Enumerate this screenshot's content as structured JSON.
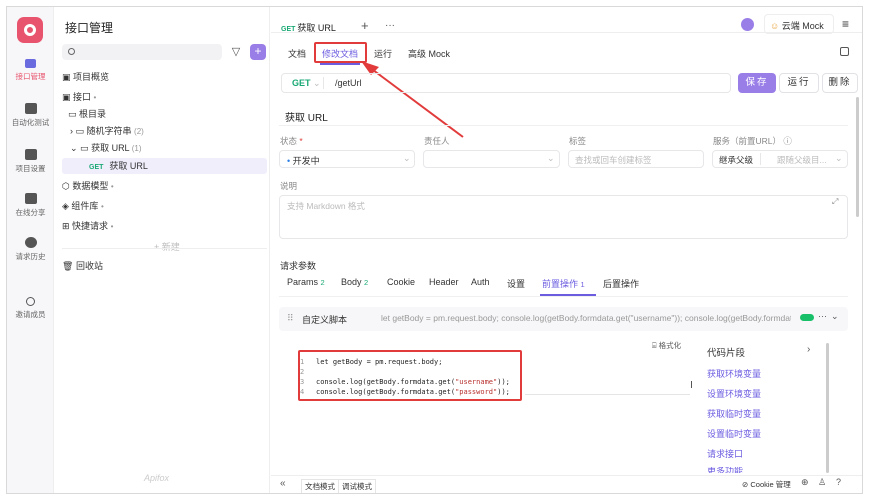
{
  "rail": {
    "items": [
      {
        "label": "接口管理",
        "icon": "api-icon"
      },
      {
        "label": "自动化测试",
        "icon": "automation-icon"
      },
      {
        "label": "项目设置",
        "icon": "settings-icon"
      },
      {
        "label": "在线分享",
        "icon": "share-icon"
      },
      {
        "label": "请求历史",
        "icon": "history-icon"
      },
      {
        "label": "邀请成员",
        "icon": "invite-icon"
      }
    ]
  },
  "tree": {
    "title": "接口管理",
    "search_placeholder": "",
    "items": {
      "overview": "项目概览",
      "interface": "接口",
      "interface_caret": "•",
      "root": "根目录",
      "random_string": "随机字符串",
      "random_string_count": "(2)",
      "get_url_folder": "获取 URL",
      "get_url_folder_count": "(1)",
      "get_method": "GET",
      "get_url": "获取 URL",
      "data_model": "数据模型",
      "component_lib": "组件库",
      "quick_request": "快捷请求",
      "new": "+ 新建",
      "recycle": "回收站"
    },
    "watermark": "Apifox"
  },
  "tabs": {
    "method": "GET",
    "title": "获取 URL",
    "add": "+",
    "more": "···"
  },
  "topright": {
    "env_label": "云端 Mock",
    "menu": "≡"
  },
  "subtabs": [
    "文档",
    "修改文档",
    "运行",
    "高级 Mock"
  ],
  "request": {
    "method": "GET",
    "url": "/getUrl",
    "save": "保存",
    "run": "运行",
    "delete": "删除"
  },
  "doc": {
    "name": "获取 URL",
    "status_label": "状态",
    "status_required": "*",
    "status_value": "开发中",
    "owner_label": "责任人",
    "tag_label": "标签",
    "tag_placeholder": "查找或回车创建标签",
    "service_label": "服务（前置URL）",
    "service_value": "继承父级",
    "service_placeholder": "跟随父级目...",
    "desc_label": "说明",
    "desc_placeholder": "支持 Markdown 格式"
  },
  "params": {
    "label": "请求参数",
    "tabs": [
      {
        "label": "Params",
        "count": "2"
      },
      {
        "label": "Body",
        "count": "2"
      },
      {
        "label": "Cookie",
        "count": ""
      },
      {
        "label": "Header",
        "count": ""
      },
      {
        "label": "Auth",
        "count": ""
      },
      {
        "label": "设置",
        "count": ""
      },
      {
        "label": "前置操作",
        "count": "1"
      },
      {
        "label": "后置操作",
        "count": ""
      }
    ]
  },
  "script": {
    "title": "自定义脚本",
    "preview": "let getBody = pm.request.body; console.log(getBody.formdata.get(\"username\")); console.log(getBody.formdata...",
    "format_btn": "格式化",
    "lines": [
      {
        "n": "1",
        "code": "let getBody = pm.request.body;",
        "str": "",
        "tail": ""
      },
      {
        "n": "2",
        "code": "",
        "str": "",
        "tail": ""
      },
      {
        "n": "3",
        "code": "console.log(getBody.formdata.get(",
        "str": "\"username\"",
        "tail": "));"
      },
      {
        "n": "4",
        "code": "console.log(getBody.formdata.get(",
        "str": "\"password\"",
        "tail": "));"
      }
    ]
  },
  "snippets": {
    "title": "代码片段",
    "items": [
      "获取环境变量",
      "设置环境变量",
      "获取临时变量",
      "设置临时变量",
      "请求接口",
      "更多功能"
    ]
  },
  "footer": {
    "collapse": "«",
    "doc_mode": "文档模式",
    "debug_mode": "调试模式",
    "cookie": "Cookie 管理"
  },
  "colors": {
    "accent": "#9a7ee8",
    "active_text": "#6b5ce0",
    "get_green": "#19a974",
    "highlight_red": "#e23b3b"
  }
}
